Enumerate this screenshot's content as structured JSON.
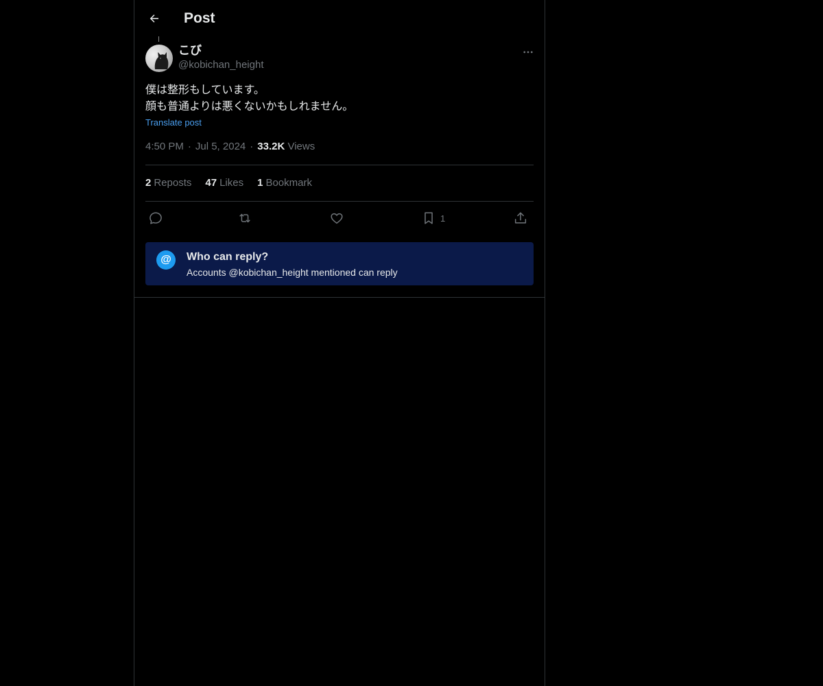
{
  "header": {
    "title": "Post",
    "back_icon": "arrow-left-icon"
  },
  "author": {
    "display_name": "こび",
    "handle": "@kobichan_height"
  },
  "post": {
    "lines": [
      "僕は整形もしています。",
      "顔も普通よりは悪くないかもしれません。"
    ],
    "translate_label": "Translate post",
    "time": "4:50 PM",
    "date": "Jul 5, 2024",
    "views_count": "33.2K",
    "views_label": "Views",
    "separator": "·"
  },
  "stats": {
    "reposts_count": "2",
    "reposts_label": "Reposts",
    "likes_count": "47",
    "likes_label": "Likes",
    "bookmarks_count": "1",
    "bookmarks_label": "Bookmark"
  },
  "actions": {
    "bookmark_count": "1",
    "icons": [
      "reply-icon",
      "repost-icon",
      "like-icon",
      "bookmark-icon",
      "share-icon"
    ]
  },
  "reply_restriction": {
    "badge": "@",
    "title": "Who can reply?",
    "subtitle": "Accounts @kobichan_height mentioned can reply"
  },
  "colors": {
    "background": "#000000",
    "text": "#e7e9ea",
    "muted": "#71767b",
    "link": "#4a9ff0",
    "notice_bg": "#0b1a49",
    "accent": "#1d9bf0"
  }
}
